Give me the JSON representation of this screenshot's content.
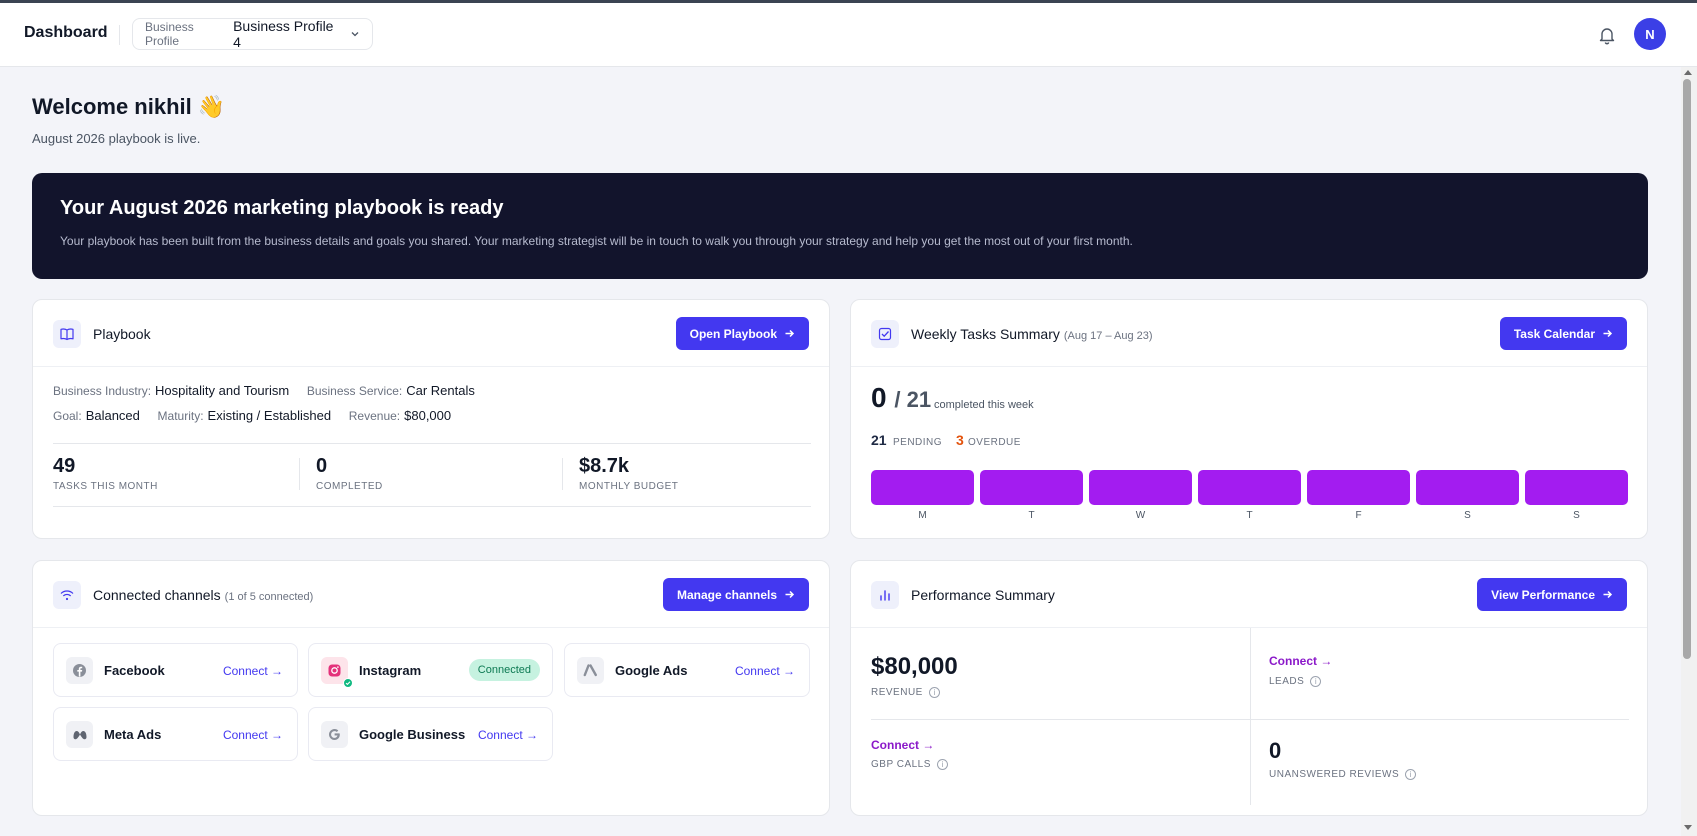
{
  "header": {
    "app_title": "Dashboard",
    "profile_label": "Business Profile",
    "profile_value": "Business Profile 4",
    "avatar_initial": "N"
  },
  "welcome": {
    "title": "Welcome nikhil 👋",
    "subtitle": "August 2026 playbook is live."
  },
  "banner": {
    "title": "Your August 2026 marketing playbook is ready",
    "text": "Your playbook has been built from the business details and goals you shared. Your marketing strategist will be in touch to walk you through your strategy and help you get the most out of your first month."
  },
  "playbook": {
    "title": "Playbook",
    "button": "Open Playbook",
    "industry_label": "Business Industry:",
    "industry": "Hospitality and Tourism",
    "service_label": "Business Service:",
    "service": "Car Rentals",
    "goal_label": "Goal:",
    "goal": "Balanced",
    "maturity_label": "Maturity:",
    "maturity": "Existing / Established",
    "revenue_label": "Revenue:",
    "revenue": "$80,000",
    "stats": [
      {
        "value": "49",
        "label": "TASKS THIS MONTH"
      },
      {
        "value": "0",
        "label": "COMPLETED"
      },
      {
        "value": "$8.7k",
        "label": "MONTHLY BUDGET"
      }
    ]
  },
  "weekly": {
    "title": "Weekly Tasks Summary",
    "range": "(Aug 17 – Aug 23)",
    "button": "Task Calendar",
    "completed": "0",
    "total": "/ 21",
    "completed_label": "completed this week",
    "pending": "21",
    "pending_label": "PENDING",
    "overdue": "3",
    "overdue_label": "OVERDUE",
    "days": [
      "M",
      "T",
      "W",
      "T",
      "F",
      "S",
      "S"
    ],
    "bar_color": "#a31cf0"
  },
  "channels": {
    "title": "Connected channels",
    "count": "(1 of 5 connected)",
    "button": "Manage channels",
    "items": [
      {
        "name": "Facebook",
        "action": "Connect →",
        "icon": "facebook-icon"
      },
      {
        "name": "Instagram",
        "status": "Connected",
        "icon": "instagram-icon"
      },
      {
        "name": "Google Ads",
        "action": "Connect →",
        "icon": "google-ads-icon"
      },
      {
        "name": "Meta Ads",
        "action": "Connect →",
        "icon": "meta-icon"
      },
      {
        "name": "Google Business",
        "action": "Connect →",
        "icon": "google-icon"
      }
    ]
  },
  "performance": {
    "title": "Performance Summary",
    "button": "View Performance",
    "revenue": "$80,000",
    "revenue_label": "REVENUE",
    "leads_action": "Connect →",
    "leads_label": "LEADS",
    "gbp_action": "Connect →",
    "gbp_label": "GBP CALLS",
    "reviews": "0",
    "reviews_label": "UNANSWERED REVIEWS"
  },
  "colors": {
    "accent": "#4338f0",
    "banner_bg": "#12142c",
    "overdue": "#e3530d",
    "connected_badge": "#c6f2e0",
    "perf_link": "#8b19c9"
  }
}
